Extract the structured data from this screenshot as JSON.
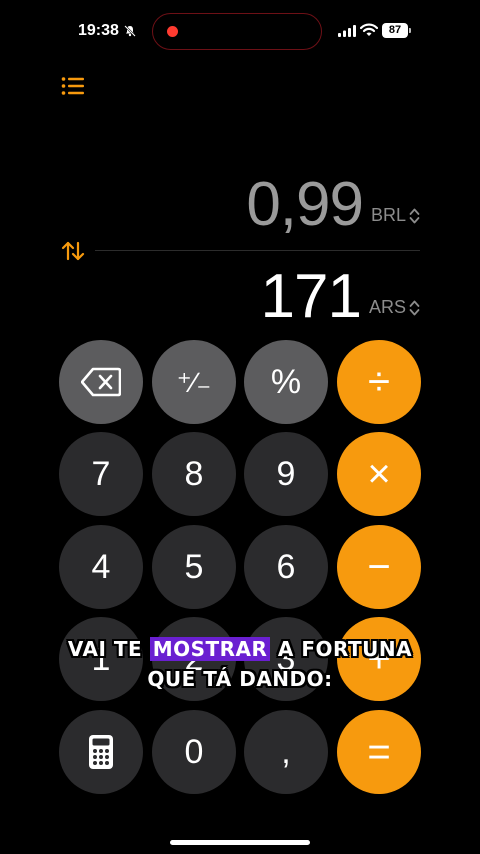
{
  "status_bar": {
    "time": "19:38",
    "battery": "87",
    "icons": [
      "bell-off-icon",
      "signal-icon",
      "wifi-icon",
      "battery-icon"
    ],
    "recording_color": "#ff3b30"
  },
  "toolbar": {
    "menu_icon": "list-icon",
    "swap_icon": "swap-arrows-icon"
  },
  "display": {
    "from_value": "0,99",
    "from_currency": "BRL",
    "to_value": "171",
    "to_currency": "ARS"
  },
  "keys": {
    "backspace": "backspace-icon",
    "plus_minus": "⁺∕₋",
    "percent": "%",
    "divide": "÷",
    "seven": "7",
    "eight": "8",
    "nine": "9",
    "multiply": "×",
    "four": "4",
    "five": "5",
    "six": "6",
    "minus": "−",
    "one": "1",
    "two": "2",
    "three": "3",
    "plus": "+",
    "calculator": "calculator-icon",
    "zero": "0",
    "decimal": ",",
    "equals": "="
  },
  "caption": {
    "before": "VAI TE ",
    "highlight": "MOSTRAR",
    "after": " A FORTUNA QUE TÁ DANDO:"
  },
  "colors": {
    "accent": "#f79a0e",
    "function_key": "#5c5c5e",
    "digit_key": "#2b2b2d",
    "caption_highlight": "#6a1fd1"
  }
}
